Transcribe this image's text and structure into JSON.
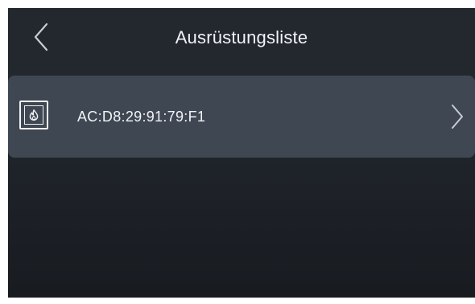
{
  "header": {
    "title": "Ausrüstungsliste",
    "back_icon": "chevron-left-icon"
  },
  "device_list": {
    "items": [
      {
        "label": "AC:D8:29:91:79:F1",
        "icon": "fireplace-flame-icon",
        "trailing_icon": "chevron-right-icon"
      }
    ]
  },
  "colors": {
    "background_top": "#262b32",
    "background_bottom": "#181b20",
    "row_background": "#3f4852",
    "text": "#f2f3f5"
  }
}
